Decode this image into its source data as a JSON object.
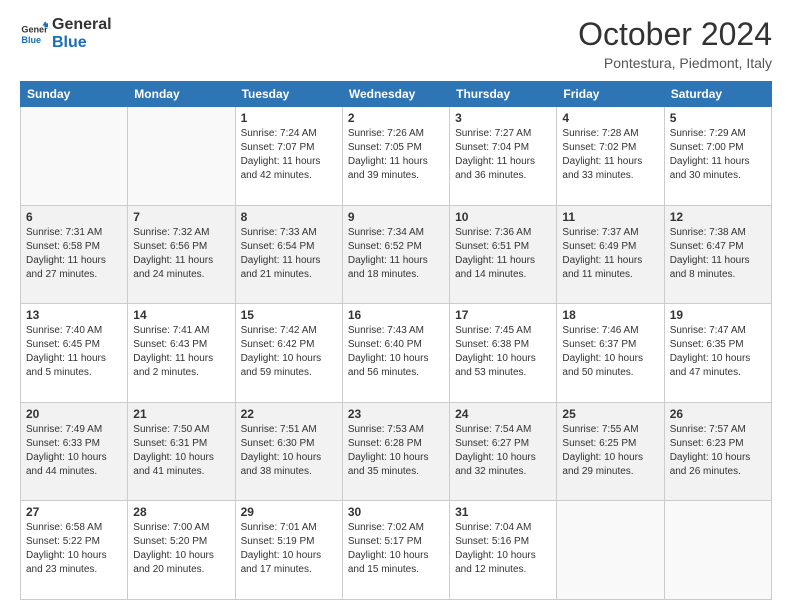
{
  "logo": {
    "line1": "General",
    "line2": "Blue"
  },
  "header": {
    "month": "October 2024",
    "location": "Pontestura, Piedmont, Italy"
  },
  "weekdays": [
    "Sunday",
    "Monday",
    "Tuesday",
    "Wednesday",
    "Thursday",
    "Friday",
    "Saturday"
  ],
  "rows": [
    [
      {
        "day": "",
        "content": ""
      },
      {
        "day": "",
        "content": ""
      },
      {
        "day": "1",
        "content": "Sunrise: 7:24 AM\nSunset: 7:07 PM\nDaylight: 11 hours and 42 minutes."
      },
      {
        "day": "2",
        "content": "Sunrise: 7:26 AM\nSunset: 7:05 PM\nDaylight: 11 hours and 39 minutes."
      },
      {
        "day": "3",
        "content": "Sunrise: 7:27 AM\nSunset: 7:04 PM\nDaylight: 11 hours and 36 minutes."
      },
      {
        "day": "4",
        "content": "Sunrise: 7:28 AM\nSunset: 7:02 PM\nDaylight: 11 hours and 33 minutes."
      },
      {
        "day": "5",
        "content": "Sunrise: 7:29 AM\nSunset: 7:00 PM\nDaylight: 11 hours and 30 minutes."
      }
    ],
    [
      {
        "day": "6",
        "content": "Sunrise: 7:31 AM\nSunset: 6:58 PM\nDaylight: 11 hours and 27 minutes."
      },
      {
        "day": "7",
        "content": "Sunrise: 7:32 AM\nSunset: 6:56 PM\nDaylight: 11 hours and 24 minutes."
      },
      {
        "day": "8",
        "content": "Sunrise: 7:33 AM\nSunset: 6:54 PM\nDaylight: 11 hours and 21 minutes."
      },
      {
        "day": "9",
        "content": "Sunrise: 7:34 AM\nSunset: 6:52 PM\nDaylight: 11 hours and 18 minutes."
      },
      {
        "day": "10",
        "content": "Sunrise: 7:36 AM\nSunset: 6:51 PM\nDaylight: 11 hours and 14 minutes."
      },
      {
        "day": "11",
        "content": "Sunrise: 7:37 AM\nSunset: 6:49 PM\nDaylight: 11 hours and 11 minutes."
      },
      {
        "day": "12",
        "content": "Sunrise: 7:38 AM\nSunset: 6:47 PM\nDaylight: 11 hours and 8 minutes."
      }
    ],
    [
      {
        "day": "13",
        "content": "Sunrise: 7:40 AM\nSunset: 6:45 PM\nDaylight: 11 hours and 5 minutes."
      },
      {
        "day": "14",
        "content": "Sunrise: 7:41 AM\nSunset: 6:43 PM\nDaylight: 11 hours and 2 minutes."
      },
      {
        "day": "15",
        "content": "Sunrise: 7:42 AM\nSunset: 6:42 PM\nDaylight: 10 hours and 59 minutes."
      },
      {
        "day": "16",
        "content": "Sunrise: 7:43 AM\nSunset: 6:40 PM\nDaylight: 10 hours and 56 minutes."
      },
      {
        "day": "17",
        "content": "Sunrise: 7:45 AM\nSunset: 6:38 PM\nDaylight: 10 hours and 53 minutes."
      },
      {
        "day": "18",
        "content": "Sunrise: 7:46 AM\nSunset: 6:37 PM\nDaylight: 10 hours and 50 minutes."
      },
      {
        "day": "19",
        "content": "Sunrise: 7:47 AM\nSunset: 6:35 PM\nDaylight: 10 hours and 47 minutes."
      }
    ],
    [
      {
        "day": "20",
        "content": "Sunrise: 7:49 AM\nSunset: 6:33 PM\nDaylight: 10 hours and 44 minutes."
      },
      {
        "day": "21",
        "content": "Sunrise: 7:50 AM\nSunset: 6:31 PM\nDaylight: 10 hours and 41 minutes."
      },
      {
        "day": "22",
        "content": "Sunrise: 7:51 AM\nSunset: 6:30 PM\nDaylight: 10 hours and 38 minutes."
      },
      {
        "day": "23",
        "content": "Sunrise: 7:53 AM\nSunset: 6:28 PM\nDaylight: 10 hours and 35 minutes."
      },
      {
        "day": "24",
        "content": "Sunrise: 7:54 AM\nSunset: 6:27 PM\nDaylight: 10 hours and 32 minutes."
      },
      {
        "day": "25",
        "content": "Sunrise: 7:55 AM\nSunset: 6:25 PM\nDaylight: 10 hours and 29 minutes."
      },
      {
        "day": "26",
        "content": "Sunrise: 7:57 AM\nSunset: 6:23 PM\nDaylight: 10 hours and 26 minutes."
      }
    ],
    [
      {
        "day": "27",
        "content": "Sunrise: 6:58 AM\nSunset: 5:22 PM\nDaylight: 10 hours and 23 minutes."
      },
      {
        "day": "28",
        "content": "Sunrise: 7:00 AM\nSunset: 5:20 PM\nDaylight: 10 hours and 20 minutes."
      },
      {
        "day": "29",
        "content": "Sunrise: 7:01 AM\nSunset: 5:19 PM\nDaylight: 10 hours and 17 minutes."
      },
      {
        "day": "30",
        "content": "Sunrise: 7:02 AM\nSunset: 5:17 PM\nDaylight: 10 hours and 15 minutes."
      },
      {
        "day": "31",
        "content": "Sunrise: 7:04 AM\nSunset: 5:16 PM\nDaylight: 10 hours and 12 minutes."
      },
      {
        "day": "",
        "content": ""
      },
      {
        "day": "",
        "content": ""
      }
    ]
  ]
}
